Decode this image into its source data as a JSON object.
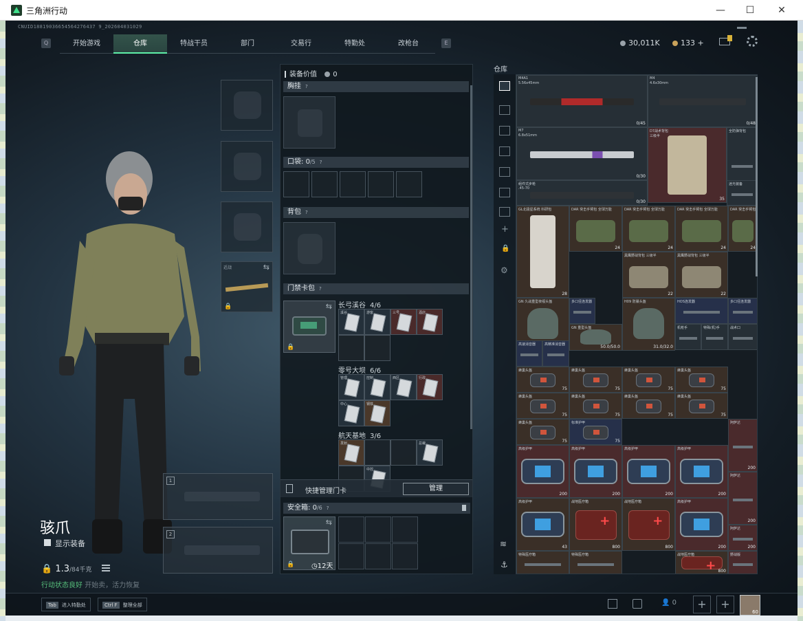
{
  "window": {
    "title": "三角洲行动",
    "controls": {
      "minimize": "—",
      "maximize": "☐",
      "close": "✕"
    }
  },
  "uid_line": "CNUID18819036654564276437 9_202604031029",
  "nav": {
    "left_key": "Q",
    "right_key": "E",
    "tabs": [
      {
        "label": "开始游戏",
        "active": false,
        "badge": false
      },
      {
        "label": "仓库",
        "active": true,
        "badge": false
      },
      {
        "label": "特战干员",
        "active": false,
        "badge": true
      },
      {
        "label": "部门",
        "active": false,
        "badge": true
      },
      {
        "label": "交易行",
        "active": false,
        "badge": false
      },
      {
        "label": "特勤处",
        "active": false,
        "badge": true
      },
      {
        "label": "改枪台",
        "active": false,
        "badge": false
      }
    ]
  },
  "currency": {
    "coins": "30,011K",
    "gold": "133",
    "gold_add": "+"
  },
  "operator": {
    "name": "骇爪",
    "show_equipment_label": "显示装备",
    "weight": "1.3",
    "weight_max": "/84千克",
    "status": "行动状态良好",
    "status_tail": "开始卖，活力恢复"
  },
  "equip_slots": {
    "melee_label": "近战",
    "weapon_slot_1": "1",
    "weapon_slot_2": "2"
  },
  "equipment": {
    "value_label": "装备价值",
    "value": "0",
    "chest_rig": "胸挂",
    "pockets": "口袋: ",
    "pockets_count": "0",
    "pockets_max": "/5",
    "backpack": "背包",
    "keycard_bag": "门禁卡包",
    "help": "?",
    "maps": [
      {
        "name": "长弓溪谷",
        "count": "4/6",
        "cards": [
          {
            "label": "溪谷",
            "tone": "on"
          },
          {
            "label": "游客",
            "tone": "on"
          },
          {
            "label": "三号",
            "tone": "red"
          },
          {
            "label": "酒店",
            "tone": "red"
          },
          {
            "label": "",
            "tone": "empty"
          },
          {
            "label": "",
            "tone": "empty"
          }
        ]
      },
      {
        "name": "零号大坝",
        "count": "6/6",
        "cards": [
          {
            "label": "管理",
            "tone": "on"
          },
          {
            "label": "控制",
            "tone": "on"
          },
          {
            "label": "西区",
            "tone": "on"
          },
          {
            "label": "行政",
            "tone": "red"
          },
          {
            "label": "中心",
            "tone": "on"
          },
          {
            "label": "钢铁",
            "tone": "brown"
          }
        ]
      },
      {
        "name": "航天基地",
        "count": "3/6",
        "cards": [
          {
            "label": "发射",
            "tone": "brown"
          },
          {
            "label": "",
            "tone": "empty"
          },
          {
            "label": "",
            "tone": "empty"
          },
          {
            "label": "总裁",
            "tone": "on"
          },
          {
            "label": "",
            "tone": "empty"
          },
          {
            "label": "中控",
            "tone": "on"
          }
        ]
      }
    ],
    "quick_manage_label": "快捷管理门卡",
    "manage_button": "管理",
    "safe_box_label": "安全箱: ",
    "safe_box_count": "0",
    "safe_box_max": "/6",
    "safe_box_time": "12天"
  },
  "warehouse": {
    "title": "仓库",
    "items": [
      {
        "name": "M4A1",
        "sub": "5.56x45mm",
        "dur": "0/45",
        "color": "grey",
        "gfx": "rifle-red"
      },
      {
        "name": "M4",
        "sub": "4.6x30mm",
        "dur": "0/48",
        "color": "grey",
        "gfx": "rifle-dark"
      },
      {
        "name": "M7",
        "sub": "6.8x51mm",
        "dur": "0/30",
        "color": "grey",
        "gfx": "rifle-white"
      },
      {
        "name": "D7战术背包",
        "sub": "三级半",
        "dur": "35",
        "color": "red",
        "gfx": "tallbag"
      },
      {
        "name": "全防弹背包",
        "sub": "",
        "dur": "",
        "color": "grey",
        "gfx": "strap"
      },
      {
        "name": "组件式步枪",
        "sub": ".45-70",
        "dur": "0/30",
        "color": "grey",
        "gfx": "rifle-dark"
      },
      {
        "name": "迷光装备",
        "sub": "",
        "dur": "",
        "color": "grey",
        "gfx": "strap"
      },
      {
        "name": "GL北极星系统 科研包",
        "sub": "",
        "dur": "28",
        "color": "brown",
        "gfx": "tallvest"
      },
      {
        "name": "DAR 突击手臂包 全球万能",
        "sub": "",
        "dur": "24",
        "color": "brown",
        "gfx": "bag"
      },
      {
        "name": "DAR 突击手臂包 全球万能",
        "sub": "",
        "dur": "24",
        "color": "brown",
        "gfx": "bag"
      },
      {
        "name": "DAR 突击手臂包 全球万能",
        "sub": "",
        "dur": "24",
        "color": "brown",
        "gfx": "bag"
      },
      {
        "name": "DAR 突击手臂包 全球万能",
        "sub": "",
        "dur": "24",
        "color": "brown",
        "gfx": "bag"
      },
      {
        "name": "黑鹰野战背包 三级半",
        "sub": "",
        "dur": "22",
        "color": "brown",
        "gfx": "bagsand"
      },
      {
        "name": "黑鹰野战背包 三级半",
        "sub": "",
        "dur": "22",
        "color": "brown",
        "gfx": "bagsand"
      },
      {
        "name": "GN 久战重型夜视头盔",
        "sub": "",
        "dur": "14.0/14.0",
        "color": "brown",
        "gfx": "helmet"
      },
      {
        "name": "多口径连发器",
        "sub": "",
        "dur": "",
        "color": "blue",
        "gfx": "strap"
      },
      {
        "name": "GN 重型头盔",
        "sub": "",
        "dur": "50.0/50.0",
        "color": "brown",
        "gfx": "helmet"
      },
      {
        "name": "H09 防暴头盔",
        "sub": "",
        "dur": "31.0/32.0",
        "color": "brown",
        "gfx": "helmet"
      },
      {
        "name": "HOS连发器",
        "sub": "",
        "dur": "",
        "color": "blue",
        "gfx": "strap"
      },
      {
        "name": "多口径连发器",
        "sub": "",
        "dur": "",
        "color": "blue",
        "gfx": "strap"
      },
      {
        "name": "高速消音器",
        "sub": "",
        "dur": "",
        "color": "blue",
        "gfx": "strap"
      },
      {
        "name": "高精准消音器",
        "sub": "",
        "dur": "",
        "color": "blue",
        "gfx": "strap"
      },
      {
        "name": "机枪手",
        "sub": "",
        "dur": "",
        "color": "grey",
        "gfx": "strap"
      },
      {
        "name": "特殊(机)手",
        "sub": "",
        "dur": "",
        "color": "grey",
        "gfx": "strap"
      },
      {
        "name": "战术口",
        "sub": "",
        "dur": "",
        "color": "grey",
        "gfx": "strap"
      },
      {
        "name": "蜂巢头盔",
        "sub": "",
        "dur": "75",
        "color": "brown",
        "gfx": "pouch"
      },
      {
        "name": "蜂巢头盔",
        "sub": "",
        "dur": "75",
        "color": "brown",
        "gfx": "pouch"
      },
      {
        "name": "蜂巢头盔",
        "sub": "",
        "dur": "75",
        "color": "brown",
        "gfx": "pouch"
      },
      {
        "name": "蜂巢头盔",
        "sub": "",
        "dur": "75",
        "color": "brown",
        "gfx": "pouch"
      },
      {
        "name": "蜂巢头盔",
        "sub": "",
        "dur": "75",
        "color": "brown",
        "gfx": "pouch"
      },
      {
        "name": "蜂巢头盔",
        "sub": "",
        "dur": "75",
        "color": "brown",
        "gfx": "pouch"
      },
      {
        "name": "蜂巢头盔",
        "sub": "",
        "dur": "75",
        "color": "brown",
        "gfx": "pouch"
      },
      {
        "name": "蜂巢头盔",
        "sub": "",
        "dur": "75",
        "color": "brown",
        "gfx": "pouch"
      },
      {
        "name": "蜂巢头盔",
        "sub": "",
        "dur": "75",
        "color": "brown",
        "gfx": "pouch"
      },
      {
        "name": "标准护甲",
        "sub": "",
        "dur": "75",
        "color": "blue",
        "gfx": "pouch"
      },
      {
        "name": "高级护甲",
        "sub": "",
        "dur": "200",
        "color": "red",
        "gfx": "armor"
      },
      {
        "name": "高级护甲",
        "sub": "",
        "dur": "200",
        "color": "red",
        "gfx": "armor"
      },
      {
        "name": "高级护甲",
        "sub": "",
        "dur": "200",
        "color": "red",
        "gfx": "armor"
      },
      {
        "name": "高级护甲",
        "sub": "",
        "dur": "200",
        "color": "red",
        "gfx": "armor"
      },
      {
        "name": "高级护甲",
        "sub": "",
        "dur": "200",
        "color": "red",
        "gfx": "armor"
      },
      {
        "name": "战地医疗箱",
        "sub": "",
        "dur": "800",
        "color": "brown",
        "gfx": "med"
      },
      {
        "name": "战地医疗箱",
        "sub": "",
        "dur": "800",
        "color": "brown",
        "gfx": "med"
      },
      {
        "name": "战地医疗箱",
        "sub": "",
        "dur": "800",
        "color": "brown",
        "gfx": "med"
      },
      {
        "name": "特殊医疗箱",
        "sub": "",
        "dur": "",
        "color": "brown",
        "gfx": "strap"
      },
      {
        "name": "特殊医疗箱",
        "sub": "",
        "dur": "",
        "color": "brown",
        "gfx": "strap"
      },
      {
        "name": "阿萨达",
        "sub": "",
        "dur": "200",
        "color": "red",
        "gfx": "strap"
      },
      {
        "name": "阿萨达",
        "sub": "",
        "dur": "200",
        "color": "red",
        "gfx": "strap"
      },
      {
        "name": "阿萨达",
        "sub": "",
        "dur": "200",
        "color": "red",
        "gfx": "strap"
      },
      {
        "name": "野战版",
        "sub": "",
        "dur": "",
        "color": "red",
        "gfx": "strap"
      },
      {
        "name": "高级护甲",
        "sub": "",
        "dur": "43",
        "color": "brown",
        "gfx": "armor"
      }
    ]
  },
  "bottom_bar": {
    "hint1_key": "Tab",
    "hint1_label": "进入特勤处",
    "hint2_key": "Ctrl F",
    "hint2_label": "整理全部",
    "friends_count": "0",
    "avatar_level": "60"
  }
}
